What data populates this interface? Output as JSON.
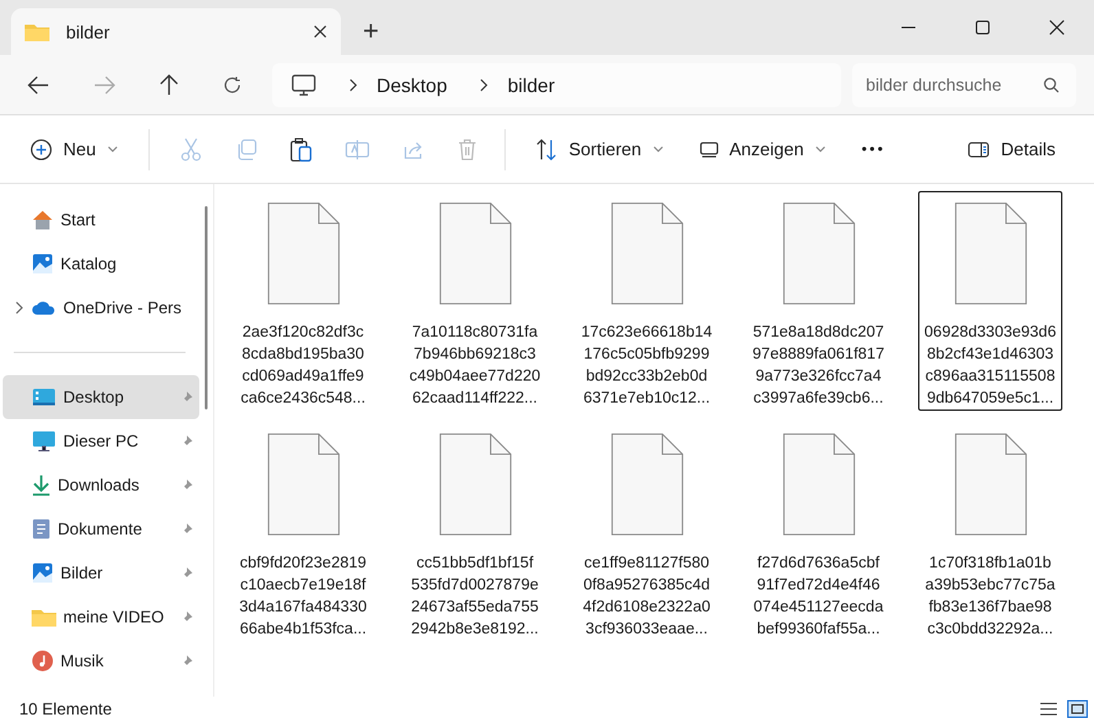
{
  "window": {
    "tab_title": "bilder",
    "new_tab": "+"
  },
  "nav": {
    "breadcrumb": [
      "Desktop",
      "bilder"
    ],
    "search": {
      "placeholder": "bilder durchsuche"
    }
  },
  "toolbar": {
    "new": {
      "label": "Neu"
    },
    "tools": [
      {
        "kind": "cut",
        "disabled": true
      },
      {
        "kind": "copy",
        "disabled": true
      },
      {
        "kind": "paste",
        "disabled": false
      },
      {
        "kind": "rename",
        "disabled": true
      },
      {
        "kind": "share",
        "disabled": true
      },
      {
        "kind": "delete",
        "disabled": true
      }
    ],
    "sort": {
      "label": "Sortieren"
    },
    "view": {
      "label": "Anzeigen"
    },
    "more": "•••",
    "details": {
      "label": "Details"
    }
  },
  "sidebar": {
    "items": [
      {
        "kind": "home",
        "label": "Start",
        "pinned": false,
        "selected": false,
        "expandable": false
      },
      {
        "kind": "gallery",
        "label": "Katalog",
        "pinned": false,
        "selected": false,
        "expandable": false
      },
      {
        "kind": "cloud",
        "label": "OneDrive - Pers",
        "pinned": false,
        "selected": false,
        "expandable": true
      },
      {
        "kind": "divider"
      },
      {
        "kind": "desktop",
        "label": "Desktop",
        "pinned": true,
        "selected": true,
        "expandable": false
      },
      {
        "kind": "pc",
        "label": "Dieser PC",
        "pinned": true,
        "selected": false,
        "expandable": false
      },
      {
        "kind": "download",
        "label": "Downloads",
        "pinned": true,
        "selected": false,
        "expandable": false
      },
      {
        "kind": "document",
        "label": "Dokumente",
        "pinned": true,
        "selected": false,
        "expandable": false
      },
      {
        "kind": "gallery",
        "label": "Bilder",
        "pinned": true,
        "selected": false,
        "expandable": false
      },
      {
        "kind": "folder",
        "label": "meine VIDEO",
        "pinned": true,
        "selected": false,
        "expandable": false
      },
      {
        "kind": "music",
        "label": "Musik",
        "pinned": true,
        "selected": false,
        "expandable": false
      }
    ]
  },
  "files": [
    {
      "lines": [
        "2ae3f120c82df3c",
        "8cda8bd195ba30",
        "cd069ad49a1ffe9",
        "ca6ce2436c548..."
      ],
      "selected": false
    },
    {
      "lines": [
        "7a10118c80731fa",
        "7b946bb69218c3",
        "c49b04aee77d220",
        "62caad114ff222..."
      ],
      "selected": false
    },
    {
      "lines": [
        "17c623e66618b14",
        "176c5c05bfb9299",
        "bd92cc33b2eb0d",
        "6371e7eb10c12..."
      ],
      "selected": false
    },
    {
      "lines": [
        "571e8a18d8dc207",
        "97e8889fa061f817",
        "9a773e326fcc7a4",
        "c3997a6fe39cb6..."
      ],
      "selected": false
    },
    {
      "lines": [
        "06928d3303e93d6",
        "8b2cf43e1d46303",
        "c896aa315115508",
        "9db647059e5c1..."
      ],
      "selected": true
    },
    {
      "lines": [
        "cbf9fd20f23e2819",
        "c10aecb7e19e18f",
        "3d4a167fa484330",
        "66abe4b1f53fca..."
      ],
      "selected": false
    },
    {
      "lines": [
        "cc51bb5df1bf15f",
        "535fd7d0027879e",
        "24673af55eda755",
        "2942b8e3e8192..."
      ],
      "selected": false
    },
    {
      "lines": [
        "ce1ff9e81127f580",
        "0f8a95276385c4d",
        "4f2d6108e2322a0",
        "3cf936033eaae..."
      ],
      "selected": false
    },
    {
      "lines": [
        "f27d6d7636a5cbf",
        "91f7ed72d4e4f46",
        "074e451127eecda",
        "bef99360faf55a..."
      ],
      "selected": false
    },
    {
      "lines": [
        "1c70f318fb1a01b",
        "a39b53ebc77c75a",
        "fb83e136f7bae98",
        "c3c0bdd32292a..."
      ],
      "selected": false
    }
  ],
  "status_bar": {
    "count": "10 Elemente"
  }
}
